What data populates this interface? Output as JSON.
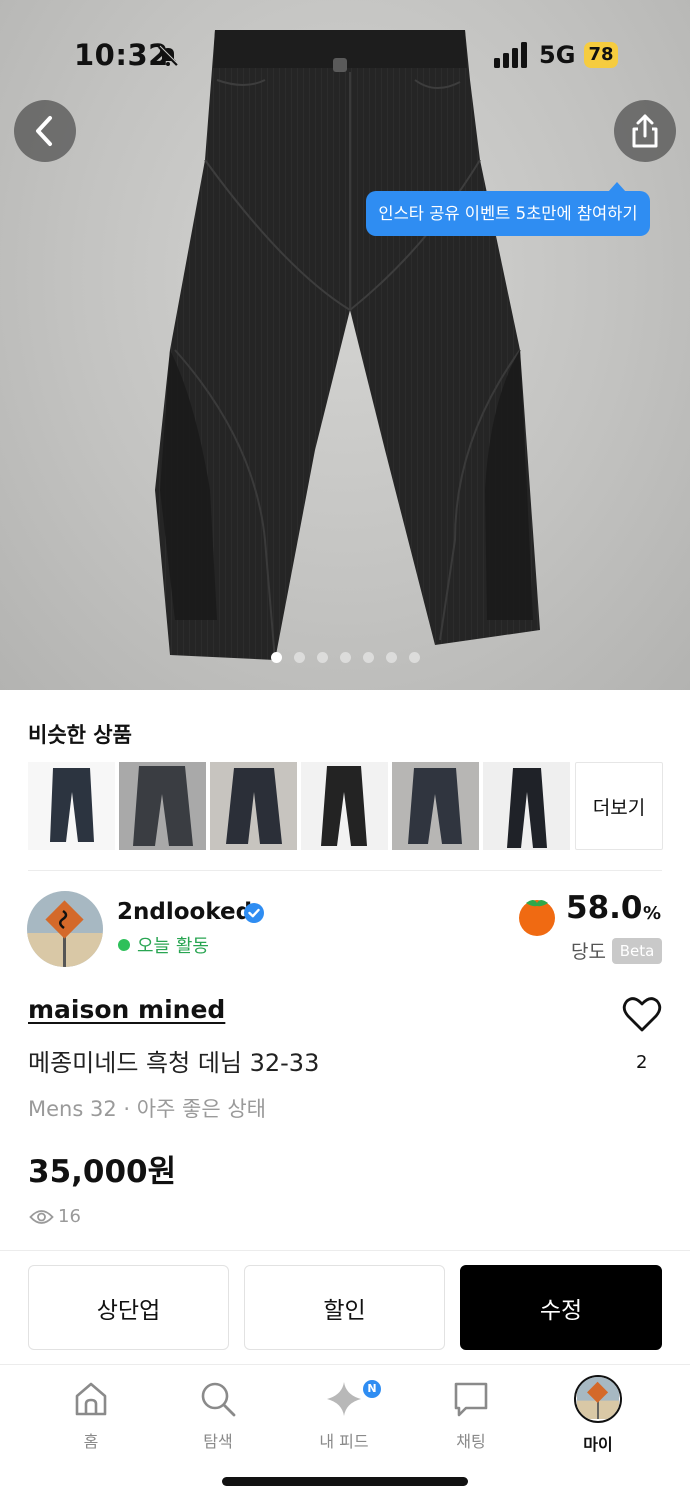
{
  "status_bar": {
    "time": "10:32",
    "network": "5G",
    "battery": "78"
  },
  "hero": {
    "tooltip": "인스타 공유 이벤트 5초만에 참여하기",
    "page_count": 7,
    "current_page": 1
  },
  "similar": {
    "title": "비슷한 상품",
    "more_label": "더보기"
  },
  "seller": {
    "name": "2ndlooked",
    "activity": "오늘 활동",
    "dangdo_value": "58.0",
    "dangdo_unit": "%",
    "dangdo_label": "당도",
    "beta_label": "Beta"
  },
  "product": {
    "brand": "maison mined",
    "title": "메종미네드 흑청 데님 32-33",
    "meta": "Mens 32 · 아주 좋은 상태",
    "price": "35,000원",
    "views": "16",
    "likes": "2"
  },
  "actions": {
    "bump": "상단업",
    "discount": "할인",
    "edit": "수정"
  },
  "tabs": {
    "home": "홈",
    "explore": "탐색",
    "feed": "내 피드",
    "feed_badge": "N",
    "chat": "채팅",
    "my": "마이"
  },
  "colors": {
    "accent_blue": "#2f8df2",
    "active_green": "#2ec05a",
    "persimmon": "#f06a12"
  }
}
